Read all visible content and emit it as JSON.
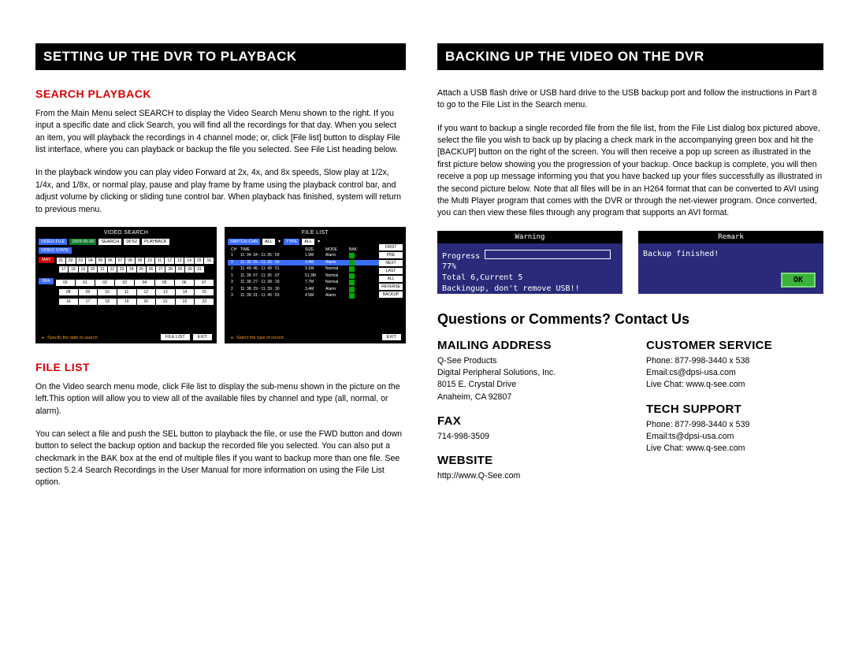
{
  "left": {
    "banner": "SETTING UP THE DVR TO PLAYBACK",
    "search_heading": "SEARCH PLAYBACK",
    "search_p1": "From the Main Menu select SEARCH to display the Video Search Menu shown to the right. If you input a specific date and click Search, you will find all the recordings for that day. When you select an item, you will playback the recordings in 4 channel mode; or, click [File list] button to display File list interface, where you can playback or backup the file you selected. See File List heading below.",
    "search_p2": "In the playback window you can play video Forward at 2x, 4x, and 8x speeds, Slow play at 1/2x, 1/4x, and 1/8x, or normal play, pause and play frame by frame using the playback control bar, and adjust volume by clicking or sliding tune control bar. When playback has finished, system will return to previous menu.",
    "filelist_heading": "FILE LIST",
    "filelist_p1": "On the Video search menu mode, click File list to display the sub-menu shown in the picture on the left.This option will allow you to view all of the available files by channel and type (all, normal, or alarm).",
    "filelist_p2": "You can select a file and push the SEL button to playback the file, or use the FWD button and down button to select the backup option and backup the recorded file you selected. You can also put a checkmark in the BAK box at the end of multiple files if you want to backup more than one file. See section 5.2.4 Search Recordings in the User Manual for more information on using the File List option.",
    "video_search": {
      "title": "VIDEO SEARCH",
      "video_file_lbl": "VIDEO FILE",
      "date": "2009-05-30",
      "search_btn": "SEARCH",
      "time": "06:52",
      "playback_btn": "PLAYBACK",
      "video_state_lbl": "VIDEO STATE",
      "month": "MAY",
      "days_r1": [
        "01",
        "02",
        "03",
        "04",
        "05",
        "06",
        "07",
        "08",
        "09",
        "10",
        "11",
        "12",
        "13",
        "14",
        "15",
        "16"
      ],
      "days_r2": [
        "17",
        "18",
        "19",
        "20",
        "21",
        "22",
        "23",
        "24",
        "25",
        "26",
        "27",
        "28",
        "29",
        "30",
        "31"
      ],
      "thirtieth": "30th",
      "hours_r1": [
        "00",
        "01",
        "02",
        "03",
        "04",
        "05",
        "06",
        "07"
      ],
      "hours_r2": [
        "08",
        "09",
        "10",
        "11",
        "12",
        "13",
        "14",
        "15"
      ],
      "hours_r3": [
        "16",
        "17",
        "18",
        "19",
        "20",
        "21",
        "22",
        "23"
      ],
      "hint": "Specify the date to search",
      "file_list_btn": "FILE LIST",
      "exit_btn": "EXIT"
    },
    "file_list_screen": {
      "title": "FILE LIST",
      "switch_chn": "SWITCH CHN",
      "all1": "ALL",
      "type": "TYPE",
      "all2": "ALL",
      "hdr": [
        "CH",
        "TIME",
        "SIZE",
        "MODE",
        "BAK"
      ],
      "rows": [
        [
          "1",
          "11: 34: 34 - 11: 35 : 59",
          "1.9M",
          "Alarm"
        ],
        [
          "3",
          "11: 35: 55 - 11: 35 : 56",
          "3.4M",
          "Alarm"
        ],
        [
          "2",
          "11: 49: 46 - 11: 49 : 51",
          "3.1M",
          "Normal"
        ],
        [
          "1",
          "11: 35: 07 - 11: 35 : 07",
          "51.3M",
          "Normal"
        ],
        [
          "3",
          "11: 36: 27 - 11: 38 : 29",
          "7.7M",
          "Normal"
        ],
        [
          "2",
          "11: 38: 29 - 11: 39 : 30",
          "3.4M",
          "Alarm"
        ],
        [
          "3",
          "11: 39: 31 - 11: 40 : 53",
          "4.5M",
          "Alarm"
        ]
      ],
      "side": [
        "FIRST",
        "PRE",
        "NEXT",
        "LAST",
        "ALL",
        "REVERSE",
        "BACKUP"
      ],
      "hint": "Select the type of record",
      "exit": "EXIT"
    }
  },
  "right": {
    "banner": "BACKING UP THE VIDEO ON THE DVR",
    "p1": "Attach a USB flash drive or USB hard drive to the USB backup port and follow the instructions in Part 8 to go to the File List in the Search menu.",
    "p2": "If you want to backup a single recorded file from the file list, from the File List dialog box pictured above, select the file you wish to back up by placing a check mark in the accompanying green box and hit the [BACKUP] button on the right of the screen. You will then receive a pop up screen as illustrated in the first picture below showing you the progression of your backup. Once backup is complete, you will then receive a pop up message informing you that you have backed up your files successfully as illustrated in the second picture below. Note that all files will be in an H264 format that can be converted to AVI using the Multi Player program that comes with the DVR or through the net-viewer program. Once converted, you can then view these files through any program that supports an AVI format.",
    "popup1": {
      "title": "Warning",
      "progress_label": "Progress",
      "pct": "77%",
      "line2": "Total 6,Current 5",
      "line3": "Backingup, don't remove USB!!"
    },
    "popup2": {
      "title": "Remark",
      "msg": "Backup finished!",
      "ok": "OK"
    },
    "q_heading": "Questions or Comments? Contact Us",
    "mailing_h": "MAILING ADDRESS",
    "mailing_lines": "Q-See Products\nDigital Peripheral Solutions, Inc.\n8015 E. Crystal Drive\nAnaheim, CA 92807",
    "fax_h": "FAX",
    "fax": "714-998-3509",
    "website_h": "WEBSITE",
    "website": "http://www.Q-See.com",
    "cs_h": "CUSTOMER SERVICE",
    "cs_body": "Phone: 877-998-3440 x 538\nEmail:cs@dpsi-usa.com\nLive Chat: www.q-see.com",
    "tech_h": "TECH SUPPORT",
    "tech_body": "Phone: 877-998-3440 x 539\nEmail:ts@dpsi-usa.com\nLive Chat: www.q-see.com"
  }
}
